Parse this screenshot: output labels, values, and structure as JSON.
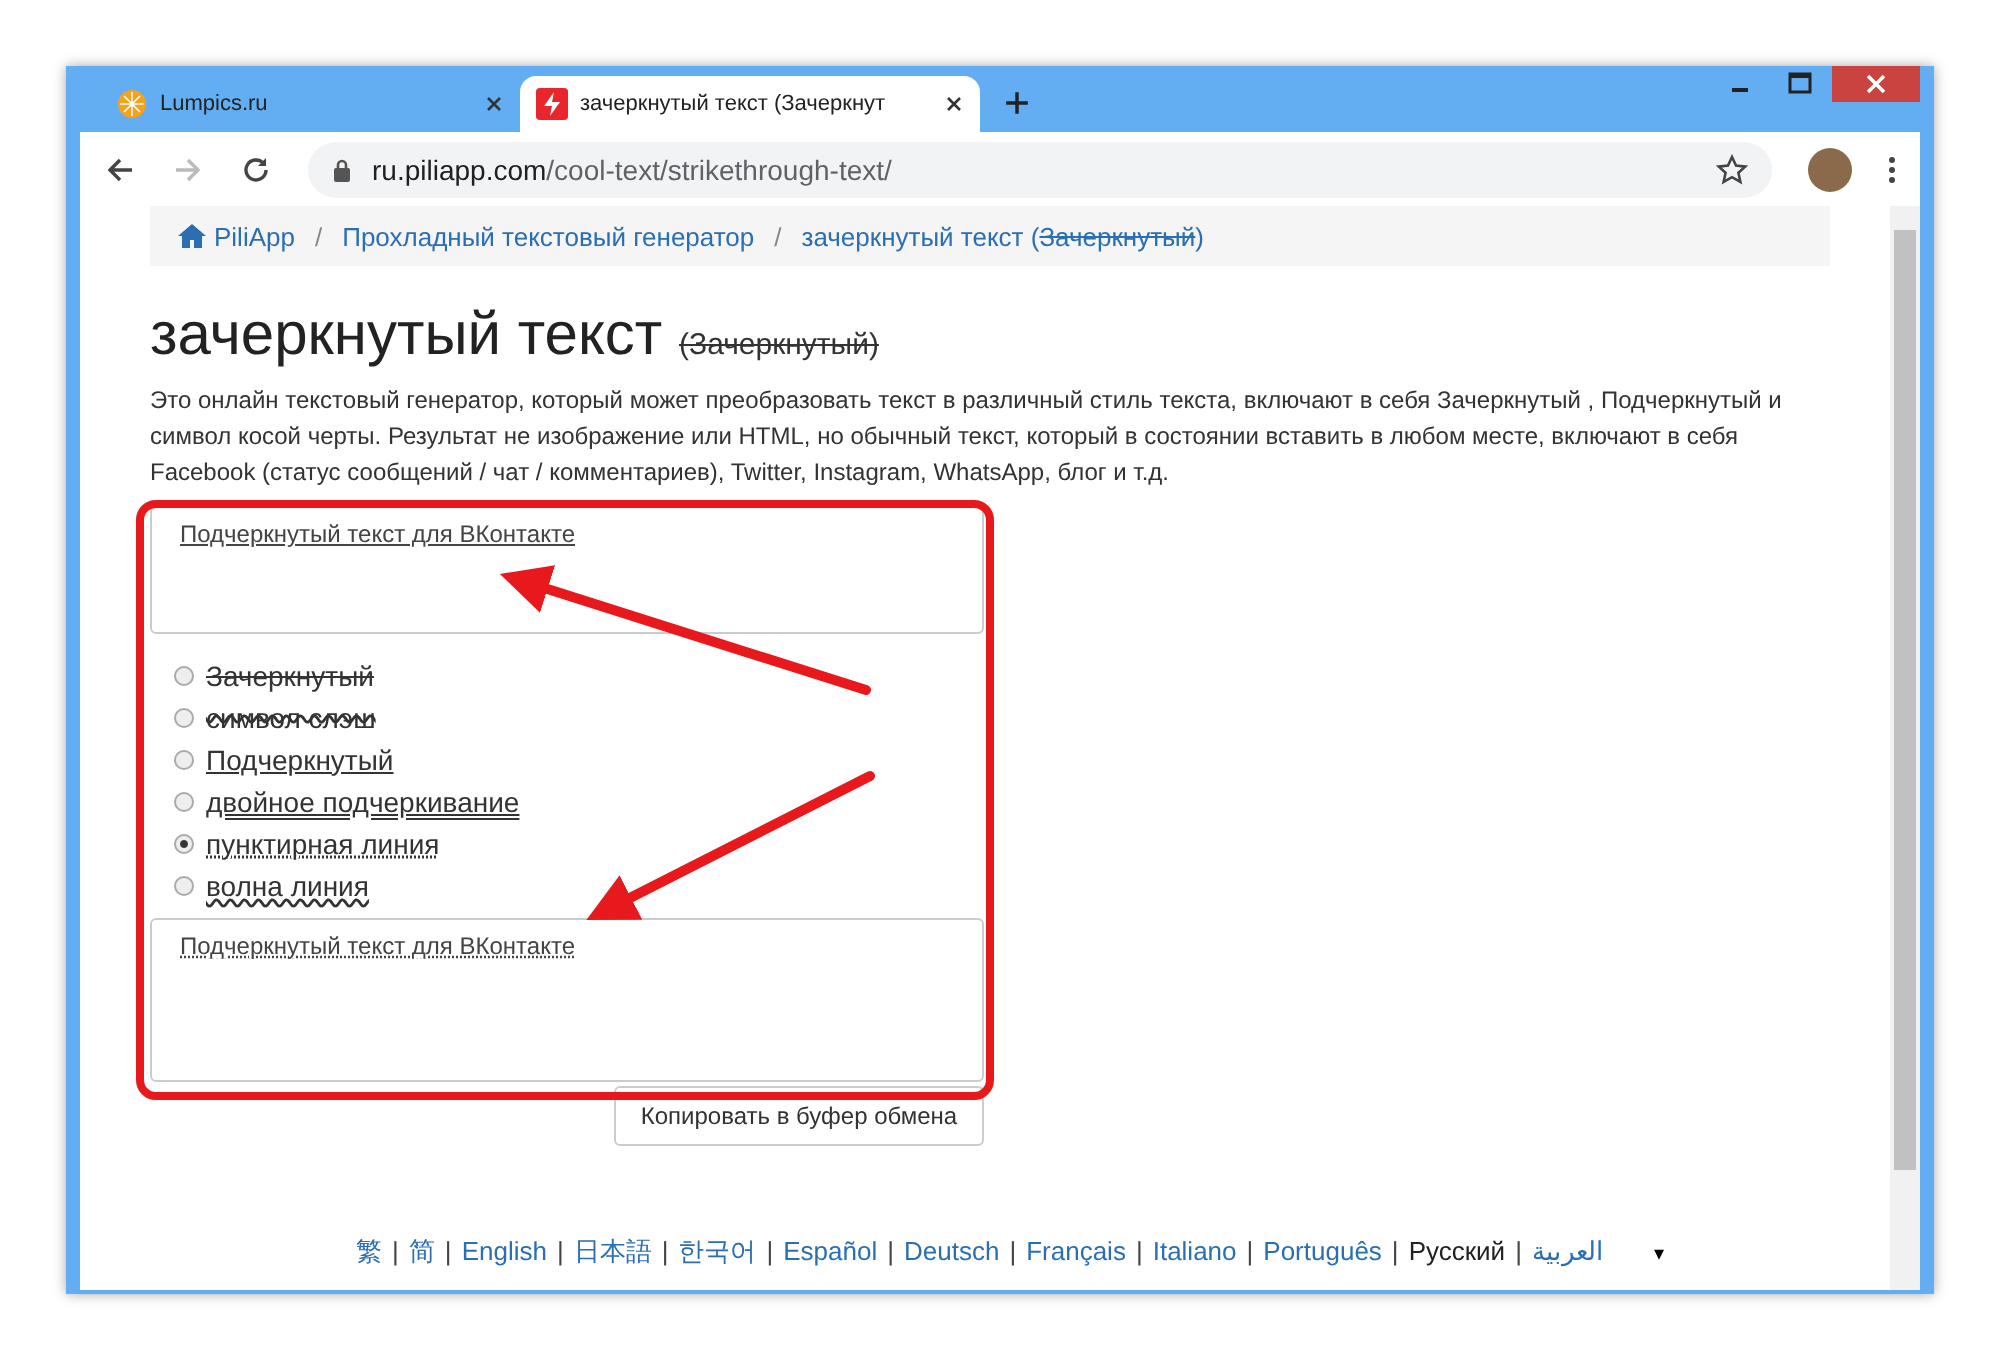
{
  "tabs": [
    {
      "title": "Lumpics.ru",
      "selected": false
    },
    {
      "title": "зачеркнутый текст (Зачеркнут",
      "selected": true
    }
  ],
  "address_bar": {
    "domain": "ru.piliapp.com",
    "path": "/cool-text/strikethrough-text/"
  },
  "breadcrumb": [
    {
      "label": "PiliApp",
      "kind": "home"
    },
    {
      "separator": "/",
      "label": "Прохладный текстовый генератор",
      "kind": "link"
    },
    {
      "separator": "/",
      "label": "зачеркнутый текст (",
      "struck": "Зачеркнутый",
      "tail": ")",
      "kind": "current"
    }
  ],
  "heading": {
    "title": "зачеркнутый текст",
    "subtitle": "(Зачеркнутый)"
  },
  "description": "Это онлайн текстовый генератор, который может преобразовать текст в различный стиль текста, включают в себя Зачеркнутый , Подчеркнутый и символ косой черты. Результат не изображение или HTML, но обычный текст, который в состоянии вставить в любом месте, включают в себя Facebook (статус сообщений / чат / комментариев), Twitter, Instagram, WhatsApp, блог и т.д.",
  "input": {
    "value": "Подчеркнутый текст для ВКонтакте"
  },
  "styles": [
    {
      "label": "Зачеркнутый",
      "kind": "strike",
      "selected": false
    },
    {
      "label": "символ слэш",
      "kind": "slash",
      "selected": false
    },
    {
      "label": "Подчеркнутый",
      "kind": "underline",
      "selected": false
    },
    {
      "label": "двойное подчеркивание",
      "kind": "double",
      "selected": false
    },
    {
      "label": "пунктирная линия",
      "kind": "dotted",
      "selected": true
    },
    {
      "label": "волна линия",
      "kind": "wave",
      "selected": false
    }
  ],
  "output": {
    "value": "Подчеркнутый текст для ВКонтакте"
  },
  "copy_button": "Копировать в буфер обмена",
  "languages": [
    {
      "label": "繁",
      "selected": false
    },
    {
      "separator": "|",
      "label": "简",
      "selected": false
    },
    {
      "separator": "|",
      "label": "English",
      "selected": false
    },
    {
      "separator": "|",
      "label": "日本語",
      "selected": false
    },
    {
      "separator": "|",
      "label": "한국어",
      "selected": false
    },
    {
      "separator": "|",
      "label": "Español",
      "selected": false
    },
    {
      "separator": "|",
      "label": "Deutsch",
      "selected": false
    },
    {
      "separator": "|",
      "label": "Français",
      "selected": false
    },
    {
      "separator": "|",
      "label": "Italiano",
      "selected": false
    },
    {
      "separator": "|",
      "label": "Português",
      "selected": false
    },
    {
      "separator": "|",
      "label": "Русский",
      "selected": true
    },
    {
      "separator": "|",
      "label": "العربية",
      "selected": false
    }
  ],
  "language_menu": "▾"
}
